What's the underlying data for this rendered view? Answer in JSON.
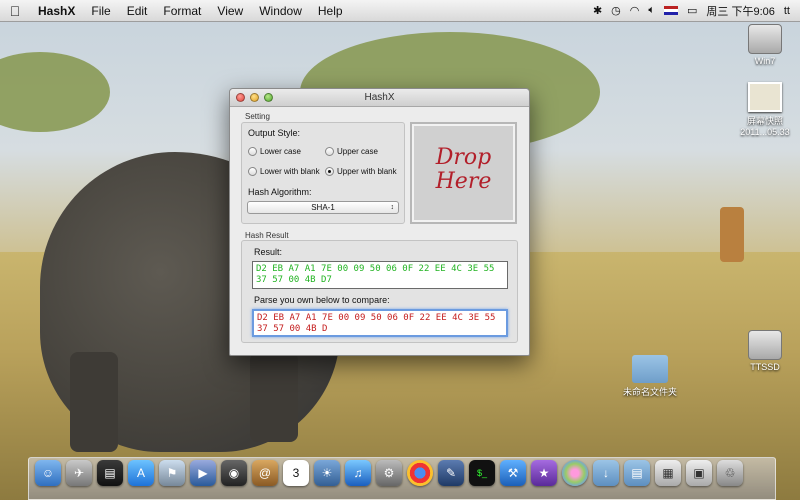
{
  "menubar": {
    "app_name": "HashX",
    "items": [
      "File",
      "Edit",
      "Format",
      "View",
      "Window",
      "Help"
    ],
    "clock": "周三 下午9:06",
    "user": "tt"
  },
  "desktop_icons": {
    "win7": "Win7",
    "screenshot": "屏幕快照 2011...05.33",
    "ssd": "TTSSD",
    "folder": "未命名文件夹"
  },
  "window": {
    "title": "HashX",
    "setting_label": "Setting",
    "output_style_label": "Output Style:",
    "radios": [
      {
        "label": "Lower case",
        "selected": false
      },
      {
        "label": "Upper case",
        "selected": false
      },
      {
        "label": "Lower with blank",
        "selected": false
      },
      {
        "label": "Upper with blank",
        "selected": true
      }
    ],
    "hash_algorithm_label": "Hash Algorithm:",
    "hash_algorithm_value": "SHA-1",
    "drop_line1": "Drop",
    "drop_line2": "Here",
    "hash_result_label": "Hash Result",
    "result_label": "Result:",
    "result_value": "D2 EB A7 A1 7E 00 09 50 06 0F 22 EE 4C 3E 55 37 57 00 4B D7",
    "compare_label": "Parse you own below to compare:",
    "compare_value": "D2 EB A7 A1 7E 00 09 50 06 0F 22 EE 4C 3E 55 37 57 00 4B D"
  },
  "dock": {
    "apps": [
      "finder",
      "launchpad",
      "dashboard",
      "app-store",
      "preview",
      "facetime",
      "photo-booth",
      "contacts",
      "calendar",
      "iphoto",
      "itunes",
      "system-preferences",
      "chrome",
      "xcode-tool",
      "terminal",
      "xcode",
      "pixelmator",
      "color-picker",
      "downloads",
      "documents",
      "grid",
      "screenshots",
      "trash"
    ],
    "calendar_day": "3"
  },
  "colors": {
    "result_text": "#22b322",
    "compare_text": "#c41d1d",
    "drop_text": "#b21f2a"
  }
}
